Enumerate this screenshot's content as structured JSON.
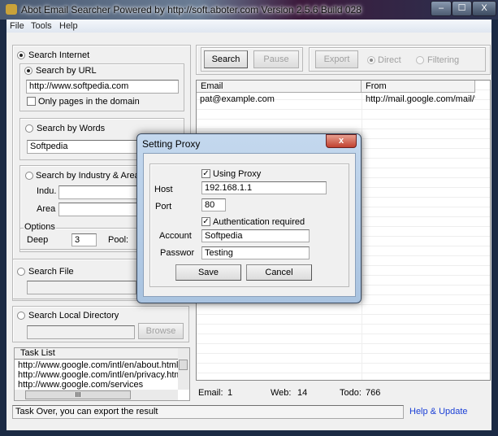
{
  "window": {
    "title": "Abot Email Searcher Powered by http://soft.aboter.com Version 2.5.6 Build 028",
    "minimize": "‒",
    "maximize": "☐",
    "close": "X"
  },
  "menu": [
    "File",
    "Tools",
    "Help"
  ],
  "left": {
    "search_internet": "Search Internet",
    "search_by_url": "Search by URL",
    "url_value": "http://www.softpedia.com",
    "only_domain": "Only pages in the domain",
    "search_by_words": "Search by Words",
    "words_value": "Softpedia",
    "search_by_industry": "Search by Industry & Area",
    "indu_label": "Indu.",
    "area_label": "Area",
    "options_label": "Options",
    "deep_label": "Deep",
    "deep_value": "3",
    "pool_label": "Pool:",
    "search_file": "Search File",
    "search_local": "Search Local Directory",
    "browse": "Browse",
    "task_list": {
      "header": "Task List",
      "items": [
        "http://www.google.com/intl/en/about.html",
        "http://www.google.com/intl/en/privacy.html",
        "http://www.google.com/services"
      ],
      "hscroll_grip": "III"
    }
  },
  "toolbar": {
    "search": "Search",
    "pause": "Pause",
    "export": "Export",
    "direct": "Direct",
    "filtering": "Filtering"
  },
  "results": {
    "columns": [
      "Email",
      "From"
    ],
    "rows": [
      [
        "pat@example.com",
        "http://mail.google.com/mail/?hl..."
      ]
    ]
  },
  "stats": {
    "email_label": "Email:",
    "email": "1",
    "web_label": "Web:",
    "web": "14",
    "todo_label": "Todo:",
    "todo": "766"
  },
  "status": "Task Over, you can export the result",
  "help_link": "Help & Update",
  "dialog": {
    "title": "Setting Proxy",
    "close": "x",
    "using_proxy": "Using Proxy",
    "host_label": "Host",
    "host": "192.168.1.1",
    "port_label": "Port",
    "port": "80",
    "auth": "Authentication required",
    "account_label": "Account",
    "account": "Softpedia",
    "password_label": "Passwor",
    "password": "Testing",
    "save": "Save",
    "cancel": "Cancel"
  },
  "colors": {
    "link": "#1a3fd6",
    "dialog_frame": "#b5cde8"
  }
}
